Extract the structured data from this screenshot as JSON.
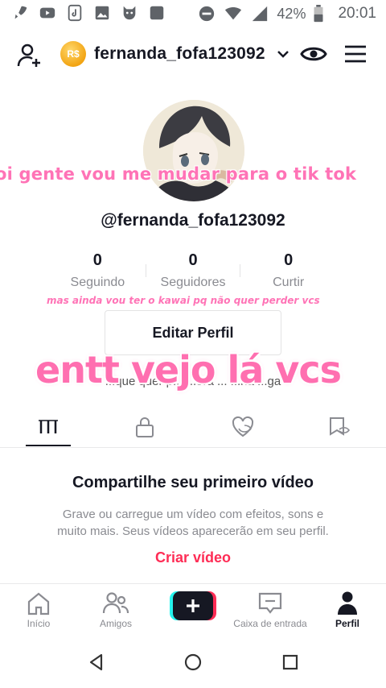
{
  "status_bar": {
    "battery": "42%",
    "time": "20:01"
  },
  "header": {
    "coin_label": "R$",
    "username": "fernanda_fofa123092"
  },
  "profile": {
    "handle": "@fernanda_fofa123092",
    "stats": [
      {
        "value": "0",
        "label": "Seguindo"
      },
      {
        "value": "0",
        "label": "Seguidores"
      },
      {
        "value": "0",
        "label": "Curtir"
      }
    ],
    "edit_button": "Editar Perfil",
    "bio_visible": "...que quer p... ...ora ... ...na ...ga"
  },
  "overlays": {
    "line1": "oi gente vou me mudar para o tik tok",
    "line2": "mas ainda vou ter o kawai pq não quer perder vcs",
    "line3": "entt vejo lá vcs"
  },
  "empty_state": {
    "title": "Compartilhe seu primeiro vídeo",
    "description": "Grave ou carregue um vídeo com efeitos, sons e muito mais. Seus vídeos aparecerão em seu perfil.",
    "cta": "Criar vídeo"
  },
  "bottom_nav": [
    {
      "label": "Início"
    },
    {
      "label": "Amigos"
    },
    {
      "label": "Caixa de entrada"
    },
    {
      "label": "Perfil"
    }
  ],
  "colors": {
    "accent_red": "#fe2c55",
    "overlay_pink": "#ff73b6",
    "coin_gold": "#f2a413"
  }
}
